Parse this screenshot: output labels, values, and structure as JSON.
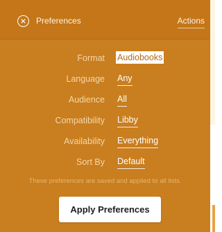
{
  "header": {
    "close_icon": "close-circle-icon",
    "title": "Preferences",
    "actions_label": "Actions"
  },
  "preferences": [
    {
      "label": "Format",
      "value": "Audiobooks",
      "selected": true
    },
    {
      "label": "Language",
      "value": "Any"
    },
    {
      "label": "Audience",
      "value": "All"
    },
    {
      "label": "Compatibility",
      "value": "Libby"
    },
    {
      "label": "Availability",
      "value": "Everything"
    },
    {
      "label": "Sort By",
      "value": "Default"
    }
  ],
  "note": "These preferences are saved and applied to all lists.",
  "apply_button": {
    "label": "Apply Preferences"
  },
  "colors": {
    "panel": "#C97E1F",
    "header": "#C47618",
    "label_text": "#F5D8A8",
    "value_text": "#FFFFFF",
    "note_text": "#E8B66E",
    "page_background": "#FBF5E3"
  }
}
